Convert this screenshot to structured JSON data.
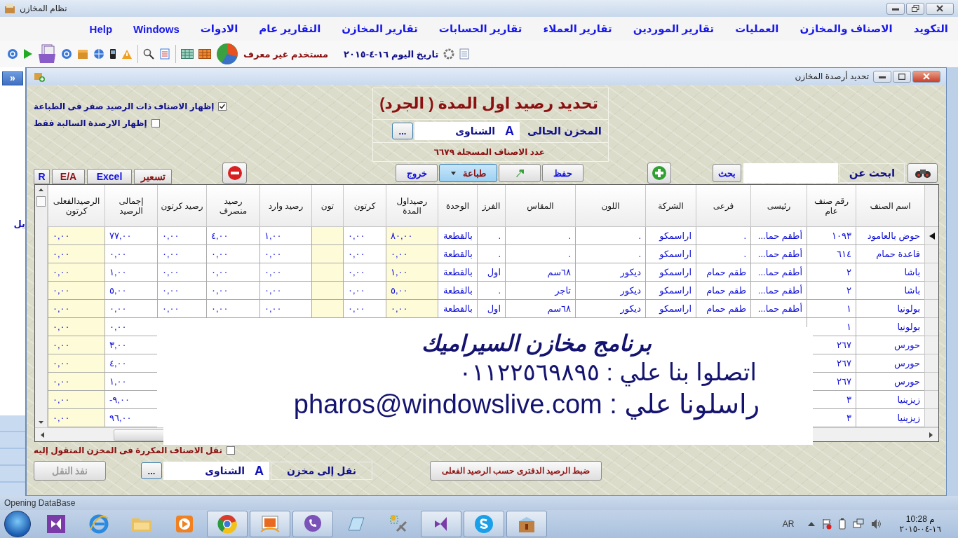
{
  "window": {
    "title": "نظام المخازن"
  },
  "menu": [
    "التكويد",
    "الاصناف والمخازن",
    "العمليات",
    "تقارير الموردين",
    "تقارير العملاء",
    "تقارير الحسابات",
    "تقارير المخازن",
    "التقارير عام",
    "الادوات",
    "Windows",
    "Help"
  ],
  "toolbar": {
    "user": "مستخدم غير معرف",
    "date": "تاريخ اليوم ١٦-٤-٢٠١٥"
  },
  "side_panel": {
    "toggle": "»",
    "label": "يل"
  },
  "child_window": {
    "title": "تحديد أرصدة المخازن"
  },
  "options": [
    {
      "label": "إظهار الاصناف ذات الرصيد صفر فى الطباعة",
      "checked": true
    },
    {
      "label": "إظهار الارصدة السالبة فقط",
      "checked": false
    }
  ],
  "header_panel": {
    "title": "تحديد رصيد اول المدة ( الجرد)",
    "store_label": "المخزن الحالى",
    "store_code": "A",
    "store_name": "الشناوى",
    "browse": "...",
    "count": "عدد الاصناف المسجلة ٦٦٧٩"
  },
  "left_buttons": [
    {
      "label": "تسعير",
      "color": "#8b1010"
    },
    {
      "label": "Excel",
      "color": "#1010e0"
    },
    {
      "label": "E/A",
      "color": "#8b1010"
    },
    {
      "label": "R",
      "color": "#1010e0"
    }
  ],
  "action_buttons": [
    {
      "kind": "text",
      "label": "حفظ",
      "color": "#1010e0"
    },
    {
      "kind": "icon"
    },
    {
      "kind": "dropdown",
      "label": "طباعة",
      "color": "#8b1010",
      "hovered": true
    },
    {
      "kind": "text",
      "label": "خروج",
      "color": "#1010e0"
    }
  ],
  "search": {
    "button": "بحث",
    "label": "ابحث عن"
  },
  "table": {
    "columns": [
      {
        "label": "اسم الصنف",
        "kind": "text",
        "highlighted": false
      },
      {
        "label": "رقم صنف عام",
        "kind": "text",
        "highlighted": false
      },
      {
        "label": "رئيسى",
        "kind": "text",
        "highlighted": false
      },
      {
        "label": "فرعى",
        "kind": "text",
        "highlighted": false
      },
      {
        "label": "الشركة",
        "kind": "text",
        "highlighted": false
      },
      {
        "label": "اللون",
        "kind": "text",
        "highlighted": false
      },
      {
        "label": "المقاس",
        "kind": "text",
        "highlighted": false
      },
      {
        "label": "الفرز",
        "kind": "text",
        "highlighted": false
      },
      {
        "label": "الوحدة",
        "kind": "text",
        "highlighted": false
      },
      {
        "label": "رصيداول المدة",
        "kind": "number",
        "highlighted": true
      },
      {
        "label": "كرتون",
        "kind": "number",
        "highlighted": false
      },
      {
        "label": "تون",
        "kind": "number",
        "highlighted": true
      },
      {
        "label": "رصيد وارد",
        "kind": "number",
        "highlighted": false
      },
      {
        "label": "رصيد منصرف",
        "kind": "number",
        "highlighted": false
      },
      {
        "label": "رصيد كرتون",
        "kind": "number",
        "highlighted": false
      },
      {
        "label": "إجمالى الرصيد",
        "kind": "number",
        "highlighted": false
      },
      {
        "label": "الرصيدالفعلى كرتون",
        "kind": "number",
        "highlighted": true
      }
    ],
    "rows": [
      {
        "current": true,
        "cells": [
          "حوض بالعامود",
          "١٠٩٣",
          "أطقم حما...",
          ".",
          "اراسمكو",
          ".",
          ".",
          ".",
          "بالقطعة",
          "٨٠,٠٠",
          "٠,٠٠",
          null,
          "١,٠٠",
          "٤,٠٠",
          "٠,٠٠",
          "٧٧,٠٠",
          "٠,٠٠"
        ]
      },
      {
        "current": false,
        "cells": [
          "قاعدة حمام",
          "٦١٤",
          "أطقم حما...",
          ".",
          "اراسمكو",
          ".",
          ".",
          ".",
          "بالقطعة",
          "٠,٠٠",
          "٠,٠٠",
          null,
          "٠,٠٠",
          "٠,٠٠",
          "٠,٠٠",
          "٠,٠٠",
          "٠,٠٠"
        ]
      },
      {
        "current": false,
        "cells": [
          "باشا",
          "٢",
          "أطقم حما...",
          "طقم حمام",
          "اراسمكو",
          "ديكور",
          "٦٨سم",
          "اول",
          "بالقطعة",
          "١,٠٠",
          "٠,٠٠",
          null,
          "٠,٠٠",
          "٠,٠٠",
          "٠,٠٠",
          "١,٠٠",
          "٠,٠٠"
        ]
      },
      {
        "current": false,
        "cells": [
          "باشا",
          "٢",
          "أطقم حما...",
          "طقم حمام",
          "اراسمكو",
          "ديكور",
          "تاجر",
          ".",
          "بالقطعة",
          "٥,٠٠",
          "٠,٠٠",
          null,
          "٠,٠٠",
          "٠,٠٠",
          "٠,٠٠",
          "٥,٠٠",
          "٠,٠٠"
        ]
      },
      {
        "current": false,
        "cells": [
          "بولونيا",
          "١",
          "أطقم حما...",
          "طقم حمام",
          "اراسمكو",
          "ديكور",
          "٦٨سم",
          "اول",
          "بالقطعة",
          "٠,٠٠",
          "٠,٠٠",
          null,
          "٠,٠٠",
          "٠,٠٠",
          "٠,٠٠",
          "٠,٠٠",
          "٠,٠٠"
        ]
      },
      {
        "current": false,
        "cells": [
          "بولونيا",
          "١",
          null,
          null,
          null,
          null,
          null,
          null,
          null,
          null,
          null,
          null,
          null,
          null,
          null,
          "٠,٠٠",
          "٠,٠٠"
        ]
      },
      {
        "current": false,
        "cells": [
          "حورس",
          "٢٦٧",
          null,
          null,
          null,
          null,
          null,
          null,
          null,
          null,
          null,
          null,
          null,
          null,
          null,
          "٣,٠٠",
          "٠,٠٠"
        ]
      },
      {
        "current": false,
        "cells": [
          "حورس",
          "٢٦٧",
          null,
          null,
          null,
          null,
          null,
          null,
          null,
          null,
          null,
          null,
          null,
          null,
          null,
          "٤,٠٠",
          "٠,٠٠"
        ]
      },
      {
        "current": false,
        "cells": [
          "حورس",
          "٢٦٧",
          null,
          null,
          null,
          null,
          null,
          null,
          null,
          null,
          null,
          null,
          null,
          null,
          null,
          "١,٠٠",
          "٠,٠٠"
        ]
      },
      {
        "current": false,
        "cells": [
          "زيزينيا",
          "٣",
          null,
          null,
          null,
          null,
          null,
          null,
          null,
          null,
          null,
          null,
          null,
          null,
          null,
          "-٩,٠٠",
          "٠,٠٠"
        ]
      },
      {
        "current": false,
        "cells": [
          "زيزينيا",
          "٣",
          null,
          null,
          null,
          null,
          null,
          null,
          null,
          null,
          null,
          null,
          null,
          null,
          null,
          "٩٦,٠٠",
          "٠,٠٠"
        ]
      }
    ]
  },
  "transfer": {
    "option": {
      "label": "نقل الاصناف المكررة فى المخزن المنقول إليه",
      "checked": false
    },
    "label": "نقل إلى مخزن",
    "store_code": "A",
    "store_name": "الشناوى",
    "browse": "...",
    "execute": {
      "label": "نفذ النقل",
      "disabled": true
    }
  },
  "adjust_button": "ضبط الرصيد الدفترى حسب الرصيد الفعلى",
  "promo": {
    "title": "برنامج مخازن السيراميك",
    "phone": "اتصلوا بنا علي : ٠١١٢٢٥٦٩٨٩٥",
    "email": "راسلونا علي : pharos@windowslive.com"
  },
  "status_bar": "Opening DataBase",
  "taskbar": {
    "apps": [
      {
        "open": false
      },
      {
        "open": false
      },
      {
        "open": false
      },
      {
        "open": false
      },
      {
        "open": true
      },
      {
        "open": true
      },
      {
        "open": true
      },
      {
        "open": false
      },
      {
        "open": false
      },
      {
        "open": true
      },
      {
        "open": true
      },
      {
        "open": true
      }
    ],
    "language": "AR",
    "time": "10:28 م",
    "date": "١٦-٠٤-٢٠١٥"
  }
}
